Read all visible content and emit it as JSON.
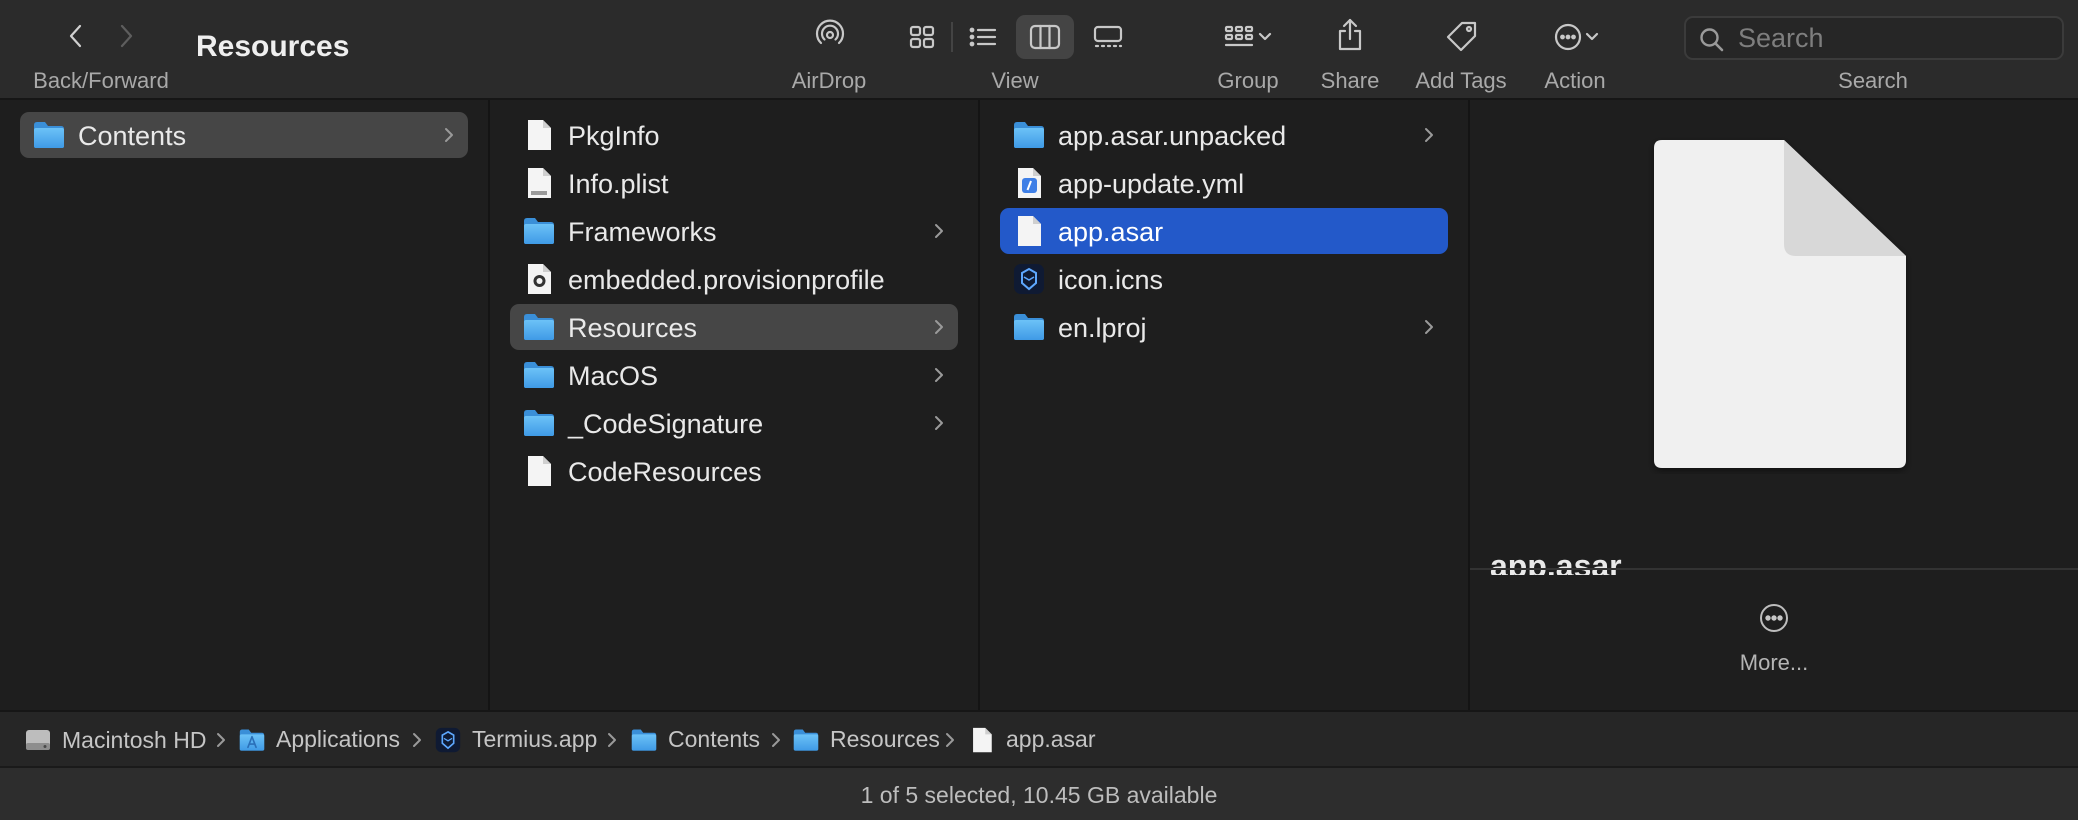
{
  "window": {
    "title": "Resources"
  },
  "toolbar": {
    "back_forward_label": "Back/Forward",
    "airdrop_label": "AirDrop",
    "view_label": "View",
    "group_label": "Group",
    "share_label": "Share",
    "add_tags_label": "Add Tags",
    "action_label": "Action",
    "search_label": "Search",
    "search_placeholder": "Search",
    "search_value": ""
  },
  "columns": [
    {
      "items": [
        {
          "name": "Contents",
          "icon": "folder-icon",
          "has_children": true,
          "selected": "inactive"
        }
      ]
    },
    {
      "items": [
        {
          "name": "PkgInfo",
          "icon": "document-icon"
        },
        {
          "name": "Info.plist",
          "icon": "plist-icon"
        },
        {
          "name": "Frameworks",
          "icon": "folder-icon",
          "has_children": true
        },
        {
          "name": "embedded.provisionprofile",
          "icon": "provisionprofile-icon"
        },
        {
          "name": "Resources",
          "icon": "folder-icon",
          "has_children": true,
          "selected": "inactive"
        },
        {
          "name": "MacOS",
          "icon": "folder-icon",
          "has_children": true
        },
        {
          "name": "_CodeSignature",
          "icon": "folder-icon",
          "has_children": true
        },
        {
          "name": "CodeResources",
          "icon": "document-icon"
        }
      ]
    },
    {
      "items": [
        {
          "name": "app.asar.unpacked",
          "icon": "folder-icon",
          "has_children": true
        },
        {
          "name": "app-update.yml",
          "icon": "yml-icon"
        },
        {
          "name": "app.asar",
          "icon": "document-icon",
          "selected": "active"
        },
        {
          "name": "icon.icns",
          "icon": "termius-icon"
        },
        {
          "name": "en.lproj",
          "icon": "folder-icon",
          "has_children": true
        }
      ]
    }
  ],
  "preview": {
    "file_name": "app.asar",
    "more_label": "More..."
  },
  "path_bar": [
    {
      "name": "Macintosh HD",
      "icon": "hard-drive-icon"
    },
    {
      "name": "Applications",
      "icon": "applications-folder-icon"
    },
    {
      "name": "Termius.app",
      "icon": "termius-icon"
    },
    {
      "name": "Contents",
      "icon": "folder-icon"
    },
    {
      "name": "Resources",
      "icon": "folder-icon"
    },
    {
      "name": "app.asar",
      "icon": "document-icon"
    }
  ],
  "status": {
    "text": "1 of 5 selected, 10.45 GB available"
  },
  "colors": {
    "selection_active": "#2359c9",
    "selection_inactive": "#464646",
    "folder": "#5ab0f0"
  }
}
